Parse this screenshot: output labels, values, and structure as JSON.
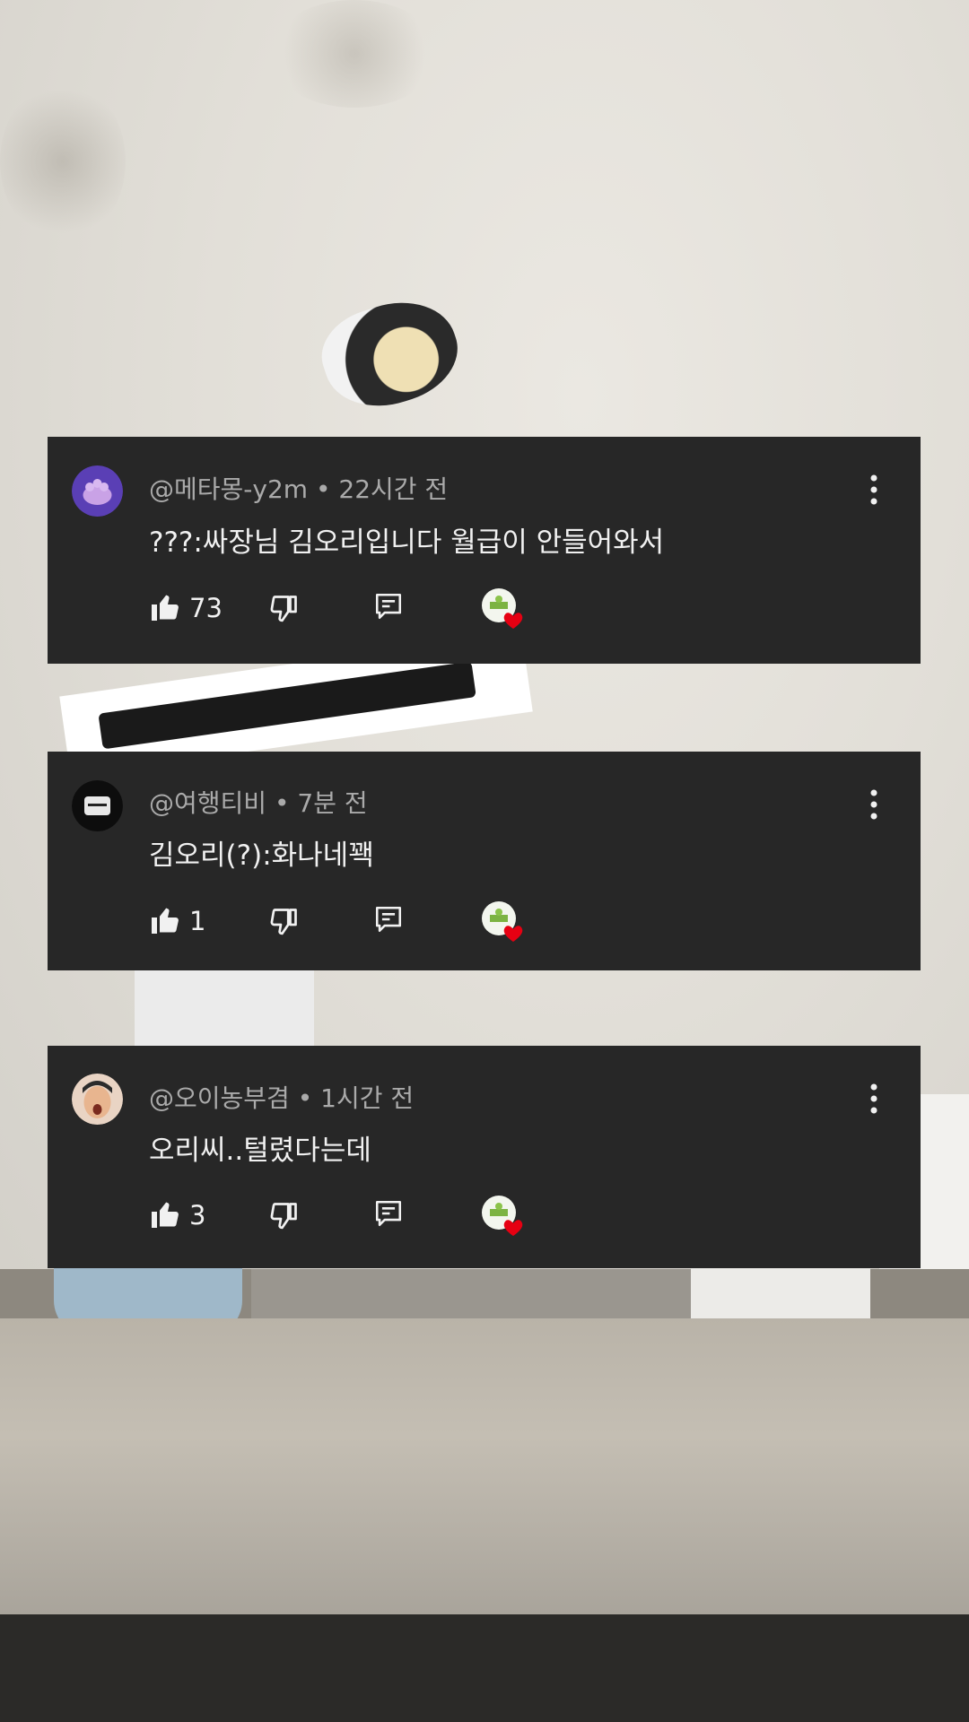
{
  "comments": [
    {
      "handle": "@메타몽-y2m",
      "time": "22시간 전",
      "text": "???:싸장님 김오리입니다 월급이 안들어와서",
      "likes": "73"
    },
    {
      "handle": "@여행티비",
      "time": "7분 전",
      "text": "김오리(?):화나네꽥",
      "likes": "1"
    },
    {
      "handle": "@오이농부겸",
      "time": "1시간 전",
      "text": "오리씨..털렸다는데",
      "likes": "3"
    }
  ],
  "separator": " • ",
  "colors": {
    "card_bg": "#272727",
    "meta_text": "#aaaaaa",
    "body_text": "#f1f1f1",
    "heart": "#e60012"
  },
  "icons": [
    "thumbs-up-icon",
    "thumbs-down-icon",
    "reply-icon",
    "creator-heart-icon",
    "more-options-icon"
  ]
}
